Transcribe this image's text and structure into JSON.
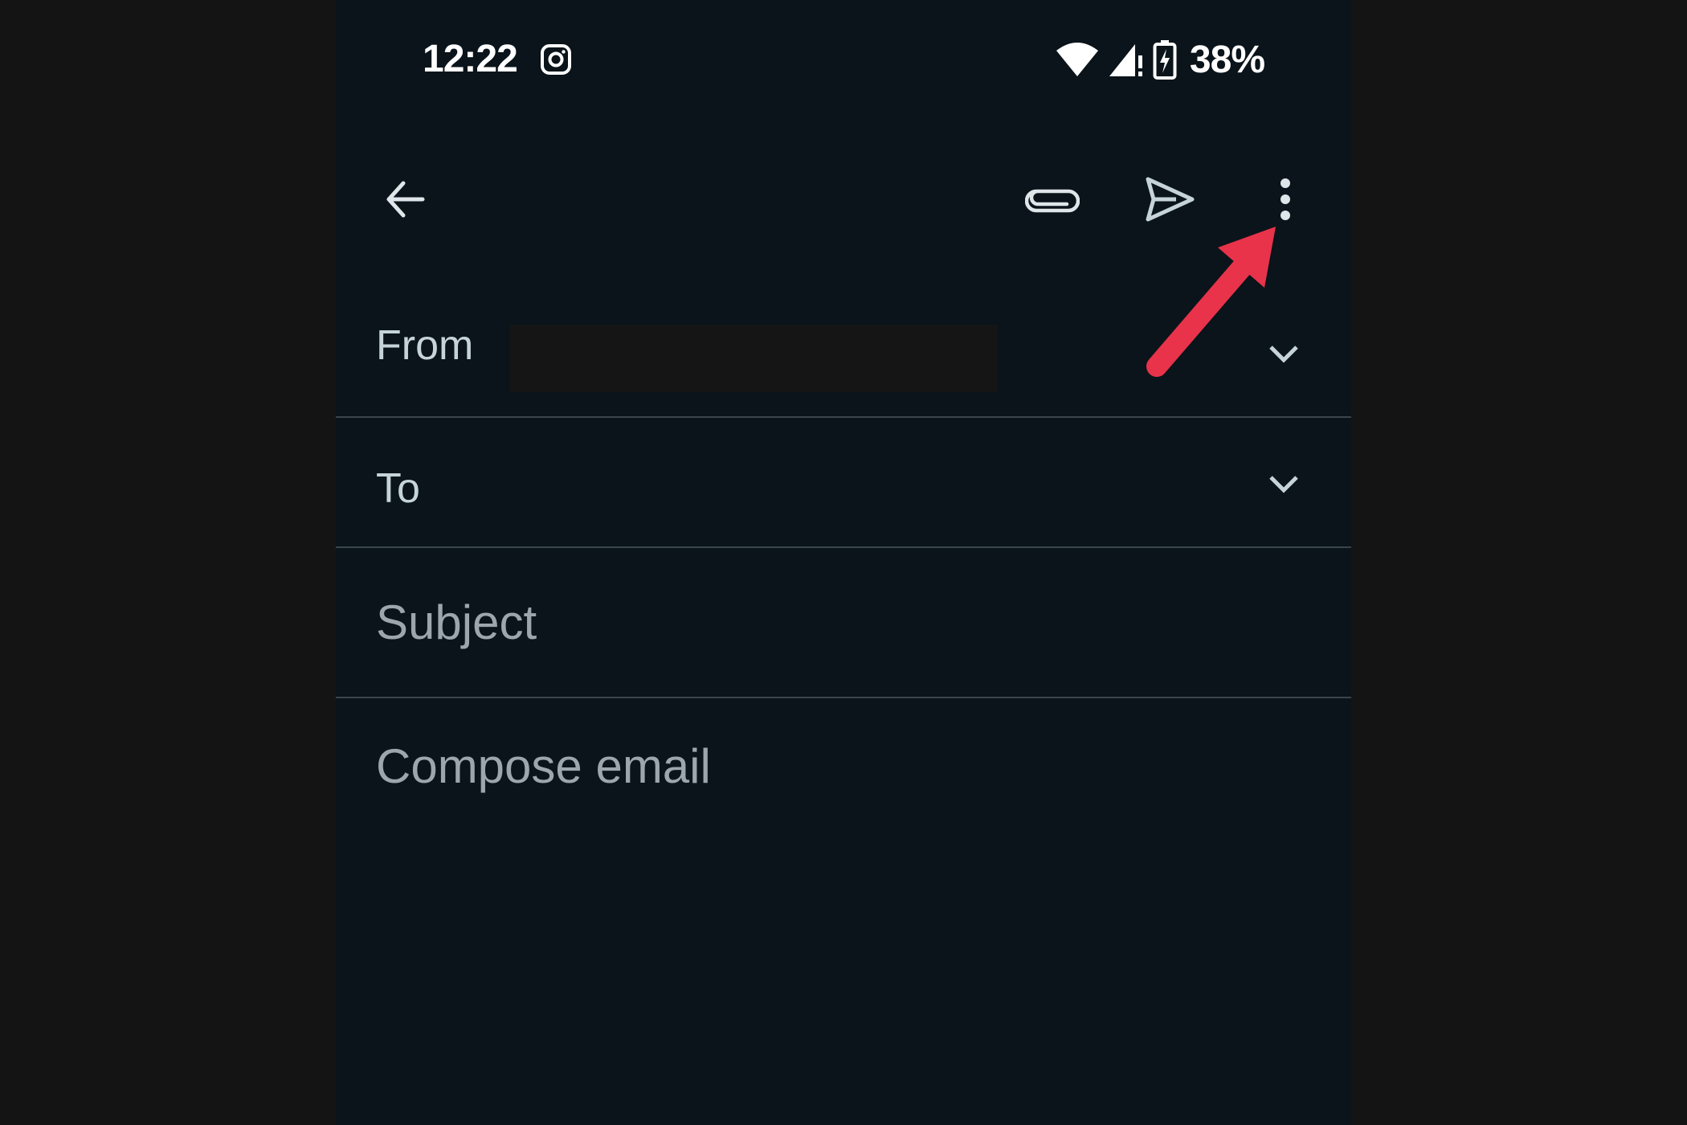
{
  "status_bar": {
    "time": "12:22",
    "notification_icon": "instagram-icon",
    "icons": [
      "wifi-icon",
      "cell-signal-no-data-icon",
      "battery-charging-icon"
    ],
    "battery_percent": "38%"
  },
  "toolbar": {
    "back_icon": "arrow-back-icon",
    "attach_icon": "paperclip-icon",
    "send_icon": "send-icon",
    "more_icon": "more-vert-icon"
  },
  "compose": {
    "from_label": "From",
    "from_value": "[redacted]",
    "to_label": "To",
    "subject_placeholder": "Subject",
    "body_placeholder": "Compose email"
  },
  "annotation": {
    "type": "arrow",
    "color": "#e8334a",
    "points_to": "more-options-button"
  }
}
